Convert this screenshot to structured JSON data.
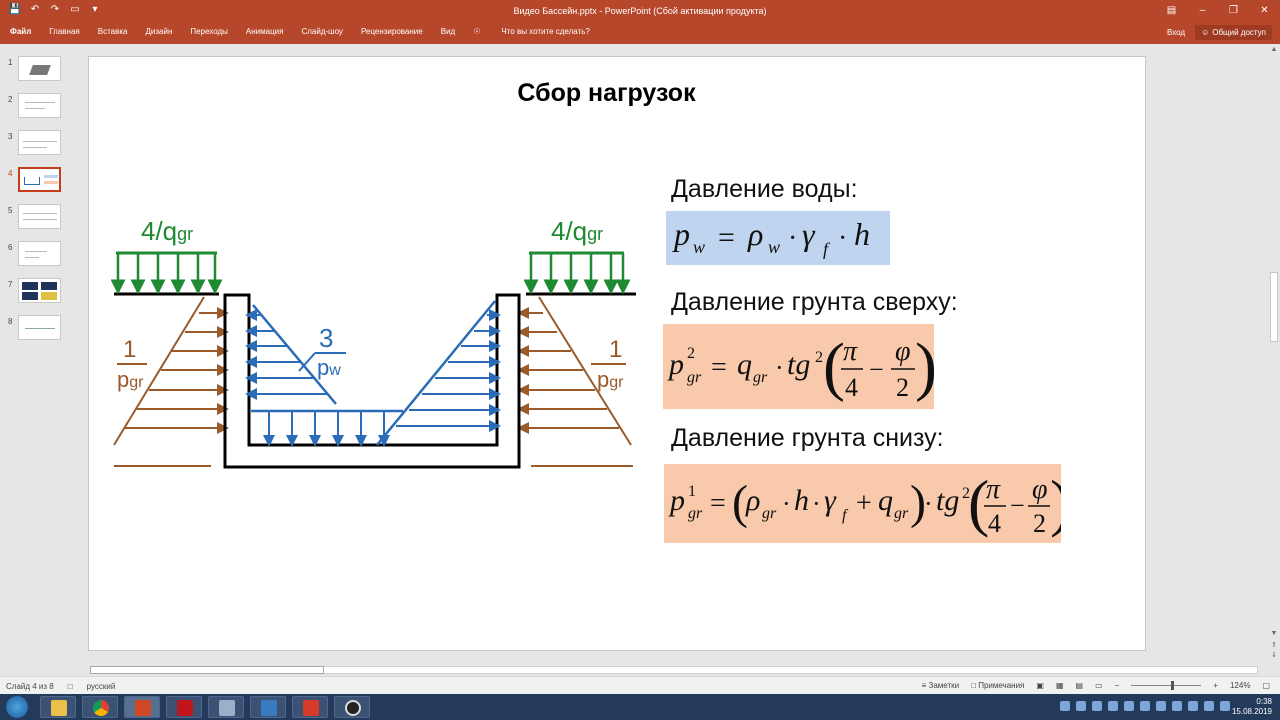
{
  "window": {
    "title": "Видео Бассейн.pptx - PowerPoint (Сбой активации продукта)"
  },
  "ribbon": {
    "tabs": [
      "Файл",
      "Главная",
      "Вставка",
      "Дизайн",
      "Переходы",
      "Анимация",
      "Слайд-шоу",
      "Рецензирование",
      "Вид"
    ],
    "tell_me": "Что вы хотите сделать?",
    "sign_in": "Вход",
    "share": "Общий доступ"
  },
  "thumbnails": {
    "numbers": [
      "1",
      "2",
      "3",
      "4",
      "5",
      "6",
      "7",
      "8"
    ],
    "active": 4
  },
  "slide": {
    "title": "Сбор нагрузок",
    "labels": {
      "water": "Давление воды:",
      "soil_top": "Давление грунта сверху:",
      "soil_bottom": "Давление грунта снизу:"
    },
    "diagram": {
      "load_left": "4/q",
      "load_right": "4/q",
      "sub_gr": "gr",
      "sub_w": "w",
      "num_1": "1",
      "num_3": "3",
      "p": "p"
    },
    "colors": {
      "blue": "#2a6cb8",
      "green": "#1e8a32",
      "brown": "#9a5a2a",
      "formula_blue": "#bfd4ee",
      "formula_orange": "#f8c9aa"
    }
  },
  "statusbar": {
    "slide_info": "Слайд 4 из 8",
    "language": "русский",
    "notes": "Заметки",
    "comments": "Примечания",
    "zoom": "124%"
  },
  "taskbar": {
    "time": "0:38",
    "date": "15.08.2019"
  }
}
